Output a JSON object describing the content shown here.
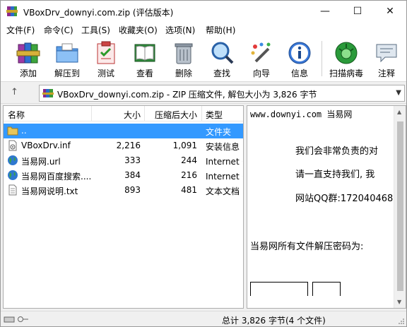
{
  "window": {
    "title": "VBoxDrv_downyi.com.zip (评估版本)",
    "controls": [
      "—",
      "☐",
      "✕"
    ]
  },
  "menu": [
    "文件(F)",
    "命令(C)",
    "工具(S)",
    "收藏夹(O)",
    "选项(N)",
    "帮助(H)"
  ],
  "toolbar": [
    {
      "label": "添加",
      "icon": "archive-books-icon"
    },
    {
      "label": "解压到",
      "icon": "folder-extract-icon"
    },
    {
      "label": "测试",
      "icon": "clipboard-check-icon"
    },
    {
      "label": "查看",
      "icon": "open-book-icon"
    },
    {
      "label": "删除",
      "icon": "trash-can-icon"
    },
    {
      "label": "查找",
      "icon": "magnifier-icon"
    },
    {
      "label": "向导",
      "icon": "magic-wand-icon"
    },
    {
      "label": "信息",
      "icon": "info-icon"
    },
    {
      "label": "扫描病毒",
      "icon": "virus-scan-icon"
    },
    {
      "label": "注释",
      "icon": "comment-icon"
    }
  ],
  "address": {
    "up": "↑",
    "path": "VBoxDrv_downyi.com.zip - ZIP 压缩文件, 解包大小为 3,826 字节"
  },
  "list": {
    "columns": {
      "name": "名称",
      "size": "大小",
      "packed": "压缩后大小",
      "type": "类型"
    },
    "rows": [
      {
        "name": "..",
        "size": "",
        "packed": "",
        "type": "文件夹",
        "icon": "folder-up-icon",
        "selected": true
      },
      {
        "name": "VBoxDrv.inf",
        "size": "2,216",
        "packed": "1,091",
        "type": "安装信息",
        "icon": "inf-file-icon"
      },
      {
        "name": "当易网.url",
        "size": "333",
        "packed": "244",
        "type": "Internet 快",
        "icon": "globe-icon"
      },
      {
        "name": "当易网百度搜索....",
        "size": "384",
        "packed": "216",
        "type": "Internet 快",
        "icon": "globe-icon"
      },
      {
        "name": "当易网说明.txt",
        "size": "893",
        "packed": "481",
        "type": "文本文档",
        "icon": "text-file-icon"
      }
    ]
  },
  "preview": {
    "line1": "www.downyi.com  当易网",
    "line2": "我们会非常负责的对",
    "line3": "请一直支持我们, 我",
    "line4": "网站QQ群:172040468",
    "line5": "当易网所有文件解压密码为:"
  },
  "status": {
    "text": "总计 3,826 字节(4 个文件)"
  },
  "colors": {
    "selection": "#3399ff",
    "chrome": "#f0f0f0",
    "border": "#adadad"
  }
}
